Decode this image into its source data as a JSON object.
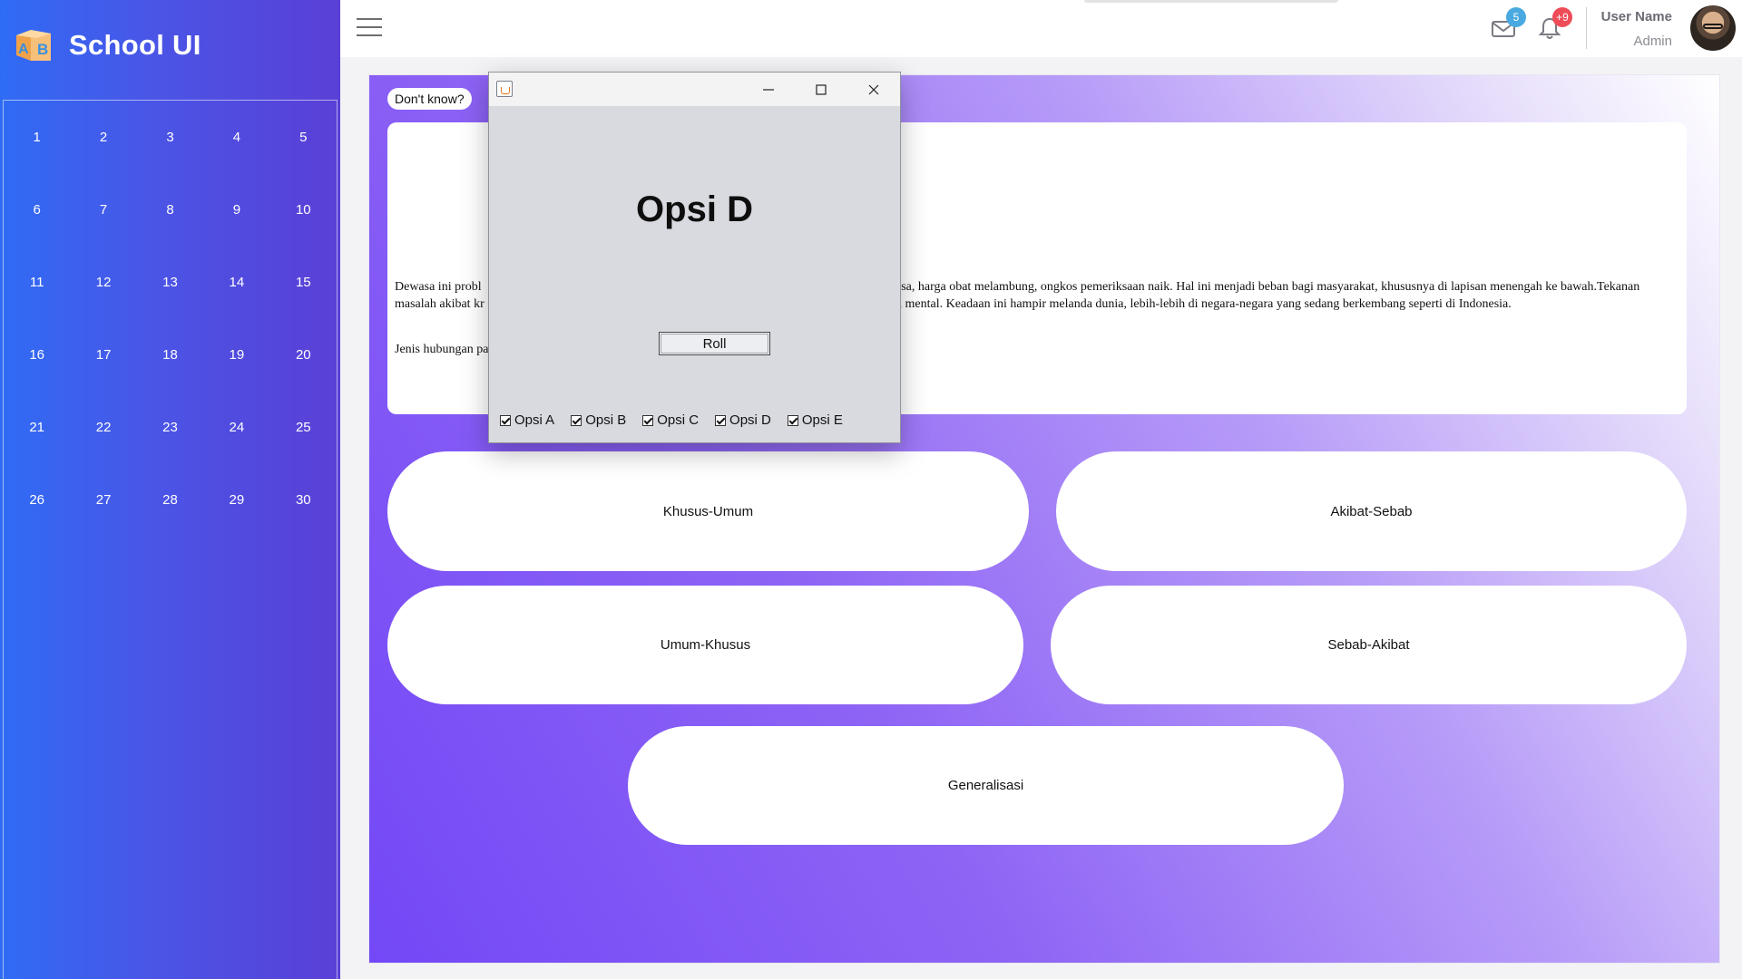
{
  "sidebar": {
    "brand": "School UI",
    "days": [
      "1",
      "2",
      "3",
      "4",
      "5",
      "6",
      "7",
      "8",
      "9",
      "10",
      "11",
      "12",
      "13",
      "14",
      "15",
      "16",
      "17",
      "18",
      "19",
      "20",
      "21",
      "22",
      "23",
      "24",
      "25",
      "26",
      "27",
      "28",
      "29",
      "30"
    ]
  },
  "topbar": {
    "mail_count": "5",
    "notification_count": "+9",
    "user_name": "User Name",
    "user_role": "Admin"
  },
  "main": {
    "dont_know_label": "Don't know?",
    "question": {
      "line1_left": "Dewasa ini probl",
      "line1_right": "asa, harga obat melambung, ongkos pemeriksaan naik. Hal ini menjadi beban bagi masyarakat, khususnya di lapisan menengah ke bawah.Tekanan",
      "line2_left": "masalah akibat kr",
      "line2_right": "n mental. Keadaan ini hampir melanda dunia, lebih-lebih di negara-negara yang sedang berkembang seperti di Indonesia.",
      "line3_left": "Jenis hubungan pa"
    },
    "answers": [
      "Khusus-Umum",
      "Akibat-Sebab",
      "Umum-Khusus",
      "Sebab-Akibat",
      "Generalisasi"
    ]
  },
  "dialog": {
    "heading": "Opsi D",
    "roll_label": "Roll",
    "options": [
      "Opsi A",
      "Opsi B",
      "Opsi C",
      "Opsi D",
      "Opsi E"
    ]
  }
}
